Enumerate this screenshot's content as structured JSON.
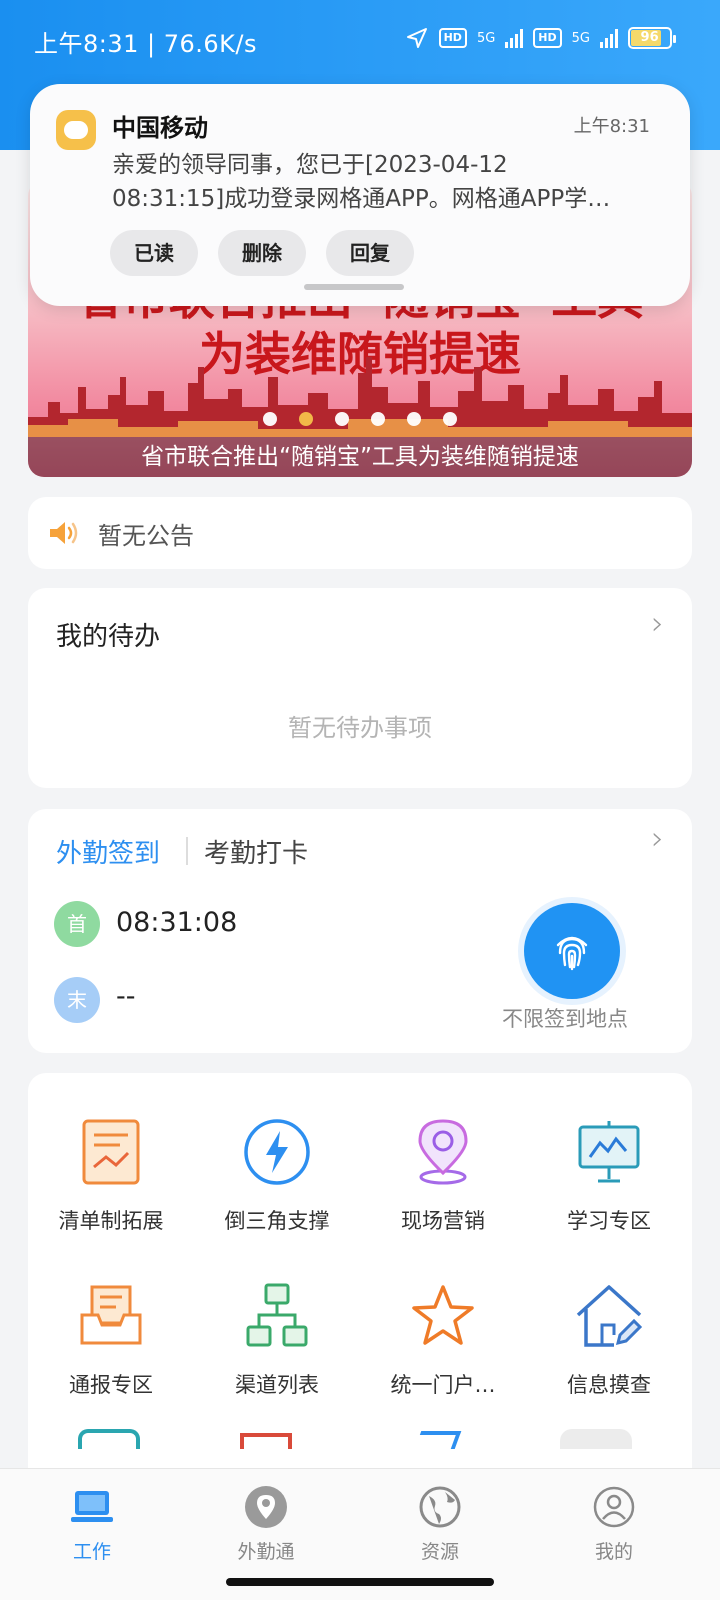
{
  "status_bar": {
    "time_speed": "上午8:31 | 76.6K/s",
    "network1": "5G",
    "network2": "5G",
    "battery": "96"
  },
  "notification": {
    "app_name": "中国移动",
    "time": "上午8:31",
    "body_line1": "亲爱的领导同事，您已于[2023-04-12",
    "body_line2": "08:31:15]成功登录网格通APP。网格通APP学…",
    "actions": [
      "已读",
      "删除",
      "回复"
    ]
  },
  "banner": {
    "headline_line1": "省市联合推出“随销宝”工具",
    "headline_line2": "为装维随销提速",
    "caption": "省市联合推出“随销宝”工具为装维随销提速",
    "slide_count": 6,
    "active_slide": 2
  },
  "notice": {
    "text": "暂无公告",
    "icon": "speaker-icon"
  },
  "todo": {
    "title": "我的待办",
    "empty_text": "暂无待办事项"
  },
  "attendance": {
    "tab_active": "外勤签到",
    "tab_other": "考勤打卡",
    "first_badge": "首",
    "first_time": "08:31:08",
    "last_badge": "末",
    "last_time": "--",
    "checkin_label": "不限签到地点"
  },
  "grid": {
    "items": [
      {
        "label": "清单制拓展",
        "icon": "checklist-chart-icon"
      },
      {
        "label": "倒三角支撑",
        "icon": "lightning-icon"
      },
      {
        "label": "现场营销",
        "icon": "location-pin-icon"
      },
      {
        "label": "学习专区",
        "icon": "presentation-board-icon"
      },
      {
        "label": "通报专区",
        "icon": "document-tray-icon"
      },
      {
        "label": "渠道列表",
        "icon": "org-chart-icon"
      },
      {
        "label": "统一门户…",
        "icon": "star-icon"
      },
      {
        "label": "信息摸查",
        "icon": "house-edit-icon"
      }
    ]
  },
  "tabbar": {
    "tabs": [
      {
        "label": "工作",
        "icon": "laptop-icon"
      },
      {
        "label": "外勤通",
        "icon": "location-icon"
      },
      {
        "label": "资源",
        "icon": "globe-icon"
      },
      {
        "label": "我的",
        "icon": "user-icon"
      }
    ],
    "active": 0
  },
  "colors": {
    "primary": "#2d8ff0",
    "banner_red": "#c8171c",
    "accent_orange": "#f6c04a"
  }
}
